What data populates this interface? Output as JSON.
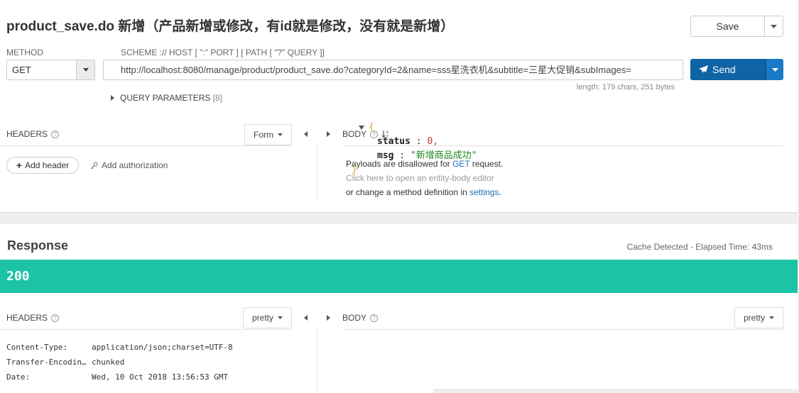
{
  "request": {
    "title": "product_save.do 新增（产品新增或修改，有id就是修改，没有就是新增）",
    "save_label": "Save",
    "method_label": "METHOD",
    "method_value": "GET",
    "scheme_label": "SCHEME :// HOST [ \":\" PORT ] [ PATH [ \"?\" QUERY ]]",
    "url": "http://localhost:8080/manage/product/product_save.do?categoryId=2&name=sss星洗衣机&subtitle=三星大促销&subImages=",
    "url_length": "length: 179 chars, 251 bytes",
    "send_label": "Send",
    "query_params_label": "QUERY PARAMETERS",
    "query_params_count": "[8]",
    "headers_label": "HEADERS",
    "headers_mode": "Form",
    "body_label": "BODY",
    "add_header_label": "Add header",
    "add_auth_label": "Add authorization",
    "payload": {
      "line1_prefix": "Payloads are disallowed for ",
      "line1_method": "GET",
      "line1_suffix": " request.",
      "line2": "Click here to open an entity-body editor",
      "line3_prefix": "or change a method definition in ",
      "line3_link": "settings",
      "line3_suffix": "."
    }
  },
  "response": {
    "title": "Response",
    "cache_info": "Cache Detected - Elapsed Time: 43ms",
    "status_code": "200",
    "status_color": "#1cc4a5",
    "headers_label": "HEADERS",
    "headers_mode": "pretty",
    "body_label": "BODY",
    "body_mode": "pretty",
    "headers": [
      {
        "key": "Content-Type:",
        "value": "application/json;charset=UTF-8"
      },
      {
        "key": "Transfer-Encodin…",
        "value": "chunked"
      },
      {
        "key": "Date:",
        "value": "Wed, 10 Oct 2018 13:56:53 GMT"
      }
    ],
    "json_body": {
      "open_brace": "{",
      "status_key": "status",
      "status_value": "0,",
      "msg_key": "msg",
      "msg_value": "\"新增商品成功\"",
      "close_brace": "}"
    }
  },
  "colors": {
    "send_button": "#0e64a5",
    "link": "#1a6fb5"
  }
}
